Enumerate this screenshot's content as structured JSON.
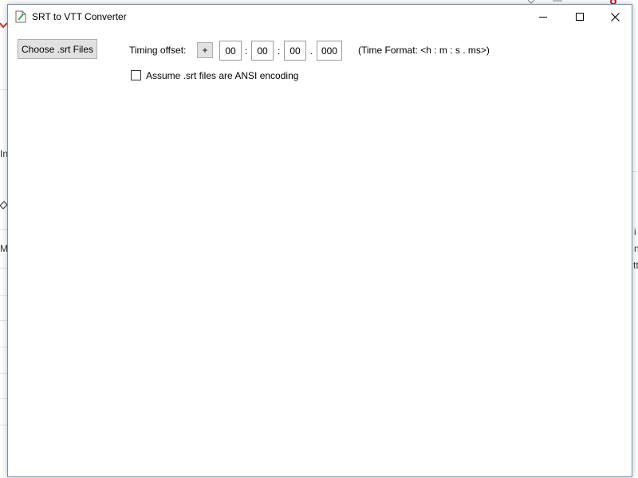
{
  "window": {
    "title": "SRT to VTT Converter"
  },
  "toolbar": {
    "choose_label": "Choose .srt Files",
    "timing_offset_label": "Timing offset:",
    "sign_label": "+",
    "hours": "00",
    "minutes": "00",
    "seconds": "00",
    "milliseconds": "000",
    "sep_colon": ":",
    "sep_dot": ".",
    "time_format_label": "(Time Format: <h : m : s . ms>)"
  },
  "options": {
    "ansi_label": "Assume .srt files are ANSI encoding",
    "ansi_checked": false
  },
  "background": {
    "frag_1": "In",
    "frag_2": "M",
    "frag_3": "i",
    "frag_4": "n",
    "frag_5": "tt"
  },
  "colors": {
    "button_face": "#e1e1e1",
    "button_border": "#adadad",
    "window_border": "#7a8fa8"
  }
}
